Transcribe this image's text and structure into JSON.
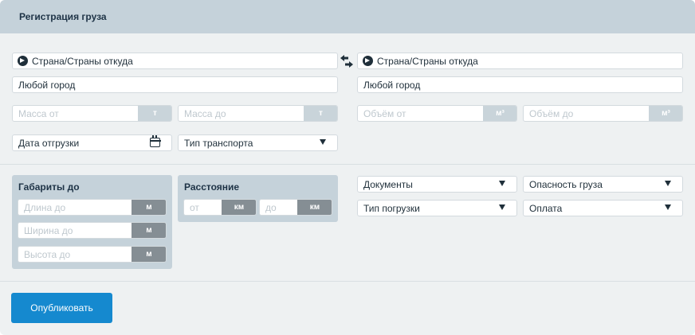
{
  "header": {
    "title": "Регистрация груза"
  },
  "route": {
    "from": {
      "country": "Страна/Страны откуда",
      "city": "Любой город"
    },
    "to": {
      "country": "Страна/Страны откуда",
      "city": "Любой город"
    }
  },
  "mass": {
    "from_placeholder": "Масса от",
    "to_placeholder": "Масса до",
    "unit": "т"
  },
  "volume": {
    "from_placeholder": "Объём от",
    "to_placeholder": "Объём до",
    "unit": "м³"
  },
  "date": {
    "label": "Дата отгрузки"
  },
  "transport": {
    "label": "Тип транспорта"
  },
  "dimensions": {
    "title": "Габариты до",
    "length_placeholder": "Длина до",
    "width_placeholder": "Ширина до",
    "height_placeholder": "Высота до",
    "unit": "м"
  },
  "distance": {
    "title": "Расстояние",
    "from_placeholder": "от",
    "to_placeholder": "до",
    "unit": "км"
  },
  "selects": {
    "documents": "Документы",
    "hazard": "Опасность груза",
    "loading": "Тип погрузки",
    "payment": "Оплата"
  },
  "actions": {
    "publish": "Опубликовать"
  },
  "colors": {
    "accent": "#1589cf",
    "header": "#c5d2da",
    "background": "#eef1f2"
  }
}
